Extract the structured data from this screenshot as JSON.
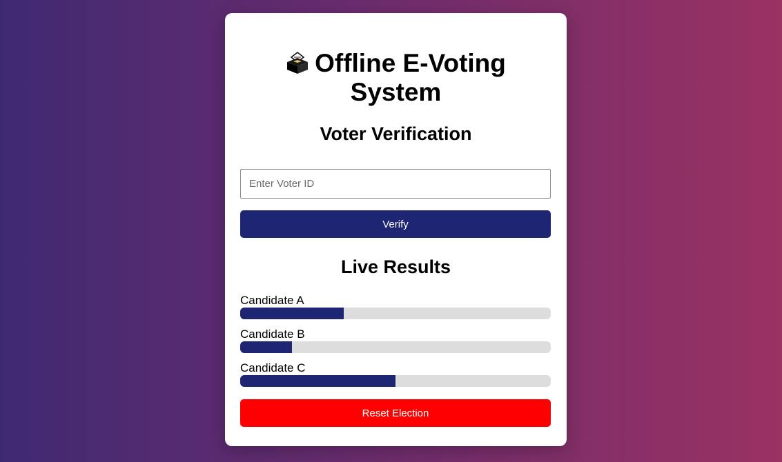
{
  "header": {
    "title_line1": "Offline E-Voting",
    "title_line2": "System",
    "title_icon": "ballot-box-icon"
  },
  "verification": {
    "heading": "Voter Verification",
    "voter_id_value": "",
    "voter_id_placeholder": "Enter Voter ID",
    "verify_label": "Verify"
  },
  "results": {
    "heading": "Live Results",
    "candidates": [
      {
        "name": "Candidate A",
        "share": 0.333
      },
      {
        "name": "Candidate B",
        "share": 0.167
      },
      {
        "name": "Candidate C",
        "share": 0.5
      }
    ]
  },
  "actions": {
    "reset_label": "Reset Election"
  },
  "colors": {
    "primary": "#1e2673",
    "danger": "#ff0000",
    "track": "#dddddd",
    "bg_start": "#3f2a72",
    "bg_end": "#9a3262"
  }
}
